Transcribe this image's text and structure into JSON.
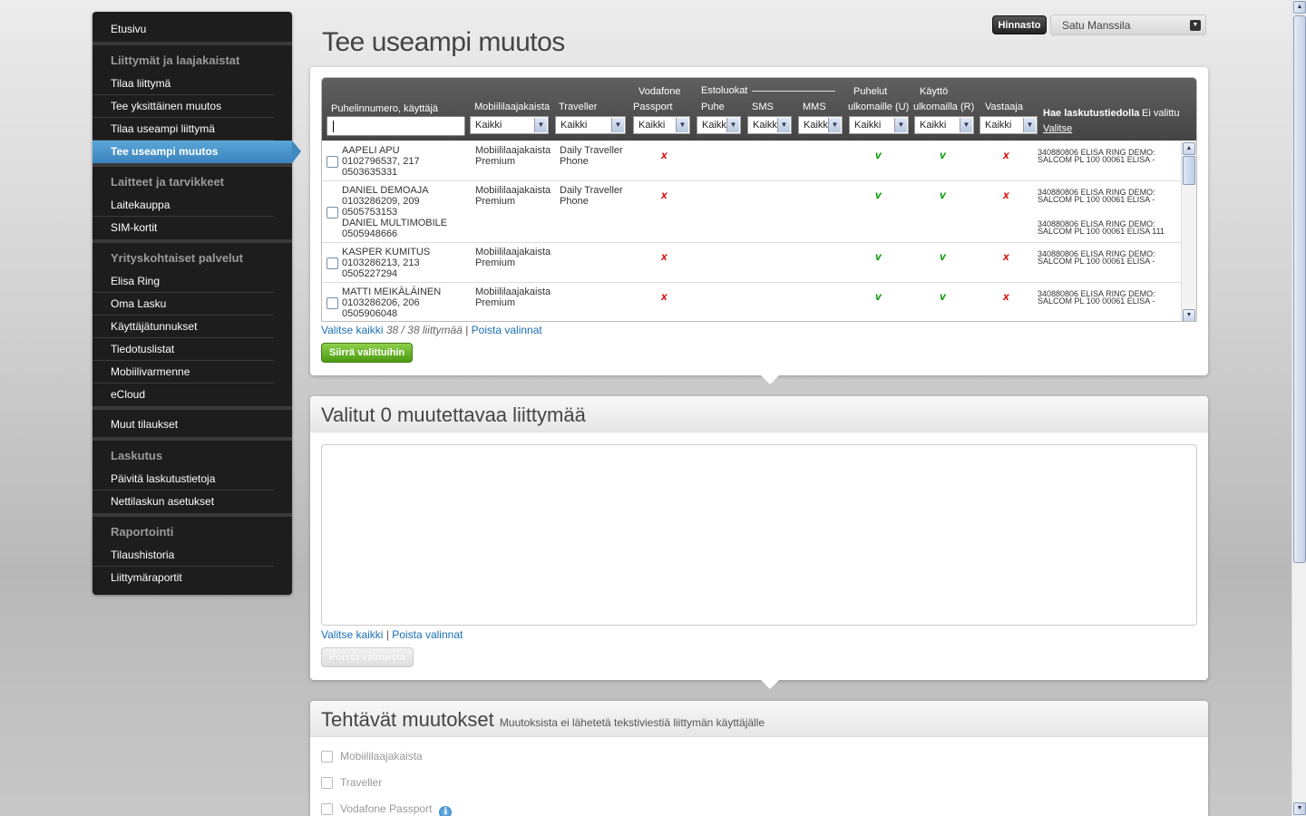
{
  "sidebar": {
    "groups": [
      {
        "heading": "",
        "items": [
          "Etusivu"
        ]
      },
      {
        "heading": "Liittymät ja laajakaistat",
        "items": [
          "Tilaa liittymä",
          "Tee yksittäinen muutos",
          "Tilaa useampi liittymä",
          "Tee useampi muutos"
        ]
      },
      {
        "heading": "Laitteet ja tarvikkeet",
        "items": [
          "Laitekauppa",
          "SIM-kortit"
        ]
      },
      {
        "heading": "Yrityskohtaiset palvelut",
        "items": [
          "Elisa Ring",
          "Oma Lasku",
          "Käyttäjätunnukset",
          "Tiedotuslistat",
          "Mobiilivarmenne",
          "eCloud"
        ]
      },
      {
        "heading": "",
        "items": [
          "Muut tilaukset"
        ]
      },
      {
        "heading": "Laskutus",
        "items": [
          "Päivitä laskutustietoja",
          "Nettilaskun asetukset"
        ]
      },
      {
        "heading": "Raportointi",
        "items": [
          "Tilaushistoria",
          "Liittymäraportit"
        ]
      }
    ],
    "active_item": "Tee useampi muutos"
  },
  "header": {
    "hinnasto_label": "Hinnasto",
    "user_name": "Satu Manssila",
    "page_title": "Tee useampi muutos"
  },
  "grid": {
    "headers": {
      "phone_user": "Puhelinnumero, käyttäjä",
      "mobile_broadband": "Mobiililaajakaista",
      "traveller": "Traveller",
      "vodafone_top": "Vodafone",
      "vodafone_bottom": "Passport",
      "barring_group": "Estoluokat",
      "puhe": "Puhe",
      "sms": "SMS",
      "mms": "MMS",
      "calls_top": "Puhelut",
      "calls_bottom": "ulkomaille (U)",
      "usage_top": "Käyttö",
      "usage_bottom": "ulkomailla (R)",
      "answer": "Vastaaja",
      "billing_label_bold": "Hae laskutustiedolla",
      "billing_label_rest": " Ei valittu",
      "billing_choose": "Valitse"
    },
    "filters": {
      "mobile_broadband": "Kaikki",
      "traveller": "Kaikki",
      "vodafone": "Kaikki",
      "puhe": "Kaikki",
      "sms": "Kaikki",
      "mms": "Kaikki",
      "calls": "Kaikki",
      "usage": "Kaikki",
      "answer": "Kaikki"
    },
    "rows": [
      {
        "name": "AAPELI APU",
        "ids": "0102796537, 217",
        "number": "0503635331",
        "extra_name": "",
        "extra_number": "",
        "mbb1": "Mobiililaajakaista",
        "mbb2": "Premium",
        "trav1": "Daily Traveller",
        "trav2": "Phone",
        "vodafone": "x",
        "calls": "v",
        "usage": "v",
        "answer": "x",
        "bill1": "340880806 ELISA RING DEMO:",
        "bill2": "SALCOM PL 100 00061 ELISA -",
        "bill3": "",
        "bill4": ""
      },
      {
        "name": "DANIEL DEMOAJA",
        "ids": "0103286209, 209",
        "number": "0505753153",
        "extra_name": "DANIEL MULTIMOBILE",
        "extra_number": "0505948666",
        "mbb1": "Mobiililaajakaista",
        "mbb2": "Premium",
        "trav1": "Daily Traveller",
        "trav2": "Phone",
        "vodafone": "x",
        "calls": "v",
        "usage": "v",
        "answer": "x",
        "bill1": "340880806 ELISA RING DEMO:",
        "bill2": "SALCOM PL 100 00061 ELISA -",
        "bill3": "340880806 ELISA RING DEMO:",
        "bill4": "SALCOM PL 100 00061 ELISA 111"
      },
      {
        "name": "KASPER KUMITUS",
        "ids": "0103286213, 213",
        "number": "0505227294",
        "extra_name": "",
        "extra_number": "",
        "mbb1": "Mobiililaajakaista",
        "mbb2": "Premium",
        "trav1": "",
        "trav2": "",
        "vodafone": "x",
        "calls": "v",
        "usage": "v",
        "answer": "x",
        "bill1": "340880806 ELISA RING DEMO:",
        "bill2": "SALCOM PL 100 00061 ELISA -",
        "bill3": "",
        "bill4": ""
      },
      {
        "name": "MATTI MEIKÄLÄINEN",
        "ids": "0103286206, 206",
        "number": "0505906048",
        "extra_name": "",
        "extra_number": "",
        "mbb1": "Mobiililaajakaista",
        "mbb2": "Premium",
        "trav1": "",
        "trav2": "",
        "vodafone": "x",
        "calls": "v",
        "usage": "v",
        "answer": "x",
        "bill1": "340880806 ELISA RING DEMO:",
        "bill2": "SALCOM PL 100 00061 ELISA -",
        "bill3": "",
        "bill4": ""
      }
    ],
    "select_all": "Valitse kaikki",
    "count_text": "38 / 38 liittymää",
    "separator": "|",
    "clear_selection": "Poista valinnat",
    "move_button": "Siirrä valittuihin"
  },
  "selected_panel": {
    "title": "Valitut 0 muutettavaa liittymää",
    "select_all": "Valitse kaikki",
    "separator": "|",
    "clear_selection": "Poista valinnat",
    "remove_button": "Poista valituista"
  },
  "changes_panel": {
    "title": "Tehtävät muutokset",
    "subtitle": "Muutoksista ei lähetetä tekstiviestiä liittymän käyttäjälle",
    "options": [
      "Mobiililaajakaista",
      "Traveller",
      "Vodafone Passport"
    ]
  },
  "colors": {
    "accent_blue": "#3a83bd",
    "green_button": "#4a9a12",
    "cross_red": "#dd0000",
    "check_green": "#009900"
  },
  "icons": {
    "yes_mark": "v",
    "no_mark": "x",
    "info": "i"
  }
}
